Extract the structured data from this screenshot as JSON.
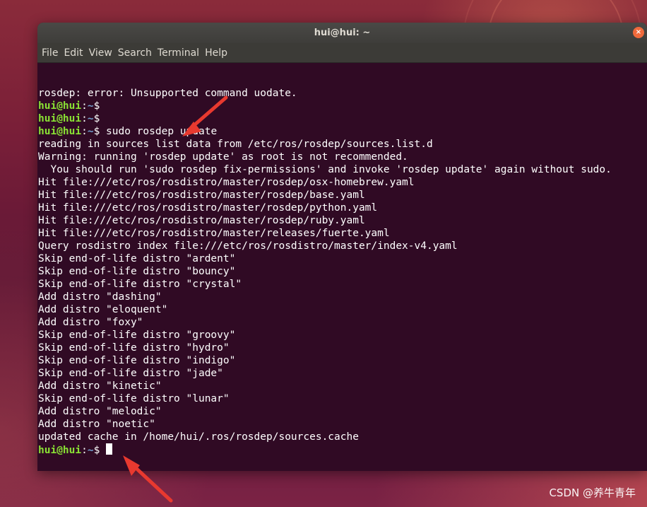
{
  "window": {
    "title": "hui@hui: ~",
    "close_symbol": "×"
  },
  "menu": {
    "items": [
      "File",
      "Edit",
      "View",
      "Search",
      "Terminal",
      "Help"
    ]
  },
  "terminal": {
    "prompt": {
      "user": "hui@hui",
      "sep": ":",
      "path": "~",
      "sym": "$"
    },
    "lines": [
      "rosdep: error: Unsupported command uodate.",
      "",
      "",
      " sudo rosdep update",
      "reading in sources list data from /etc/ros/rosdep/sources.list.d",
      "Warning: running 'rosdep update' as root is not recommended.",
      "  You should run 'sudo rosdep fix-permissions' and invoke 'rosdep update' again without sudo.",
      "Hit file:///etc/ros/rosdistro/master/rosdep/osx-homebrew.yaml",
      "Hit file:///etc/ros/rosdistro/master/rosdep/base.yaml",
      "Hit file:///etc/ros/rosdistro/master/rosdep/python.yaml",
      "Hit file:///etc/ros/rosdistro/master/rosdep/ruby.yaml",
      "Hit file:///etc/ros/rosdistro/master/releases/fuerte.yaml",
      "Query rosdistro index file:///etc/ros/rosdistro/master/index-v4.yaml",
      "Skip end-of-life distro \"ardent\"",
      "Skip end-of-life distro \"bouncy\"",
      "Skip end-of-life distro \"crystal\"",
      "Add distro \"dashing\"",
      "Add distro \"eloquent\"",
      "Add distro \"foxy\"",
      "Skip end-of-life distro \"groovy\"",
      "Skip end-of-life distro \"hydro\"",
      "Skip end-of-life distro \"indigo\"",
      "Skip end-of-life distro \"jade\"",
      "Add distro \"kinetic\"",
      "Skip end-of-life distro \"lunar\"",
      "Add distro \"melodic\"",
      "Add distro \"noetic\"",
      "updated cache in /home/hui/.ros/rosdep/sources.cache",
      " "
    ]
  },
  "watermark": "CSDN @养牛青年",
  "colors": {
    "terminal_bg": "#300a24",
    "prompt_user": "#8ae234",
    "prompt_path": "#729fcf",
    "arrow": "#e8392f"
  },
  "icons": {
    "close": "close-icon",
    "annotation": "arrow-icon"
  }
}
